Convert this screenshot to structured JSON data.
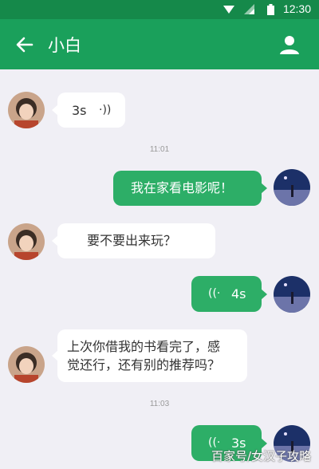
{
  "status_bar": {
    "time": "12:30"
  },
  "app_bar": {
    "title": "小白"
  },
  "messages": [
    {
      "side": "in",
      "type": "voice",
      "duration": "3s",
      "wave": "·))"
    },
    {
      "type": "timestamp",
      "text": "11:01"
    },
    {
      "side": "out",
      "type": "text",
      "text": "我在家看电影呢！"
    },
    {
      "side": "in",
      "type": "text",
      "text": "要不要出来玩？"
    },
    {
      "side": "out",
      "type": "voice",
      "duration": "4s",
      "wave": "((·"
    },
    {
      "side": "in",
      "type": "text",
      "line1": "上次你借我的书看完了，感",
      "line2": "觉还行，还有别的推荐吗？"
    },
    {
      "type": "timestamp",
      "text": "11:03"
    },
    {
      "side": "out",
      "type": "voice",
      "duration": "3s",
      "wave": "((·"
    }
  ],
  "watermark": "百家号/女汉子攻略",
  "colors": {
    "status_bar": "#15894a",
    "app_bar": "#1aa05b",
    "outgoing_bubble": "#2dae67",
    "incoming_bubble": "#ffffff",
    "background": "#f0eff5"
  }
}
